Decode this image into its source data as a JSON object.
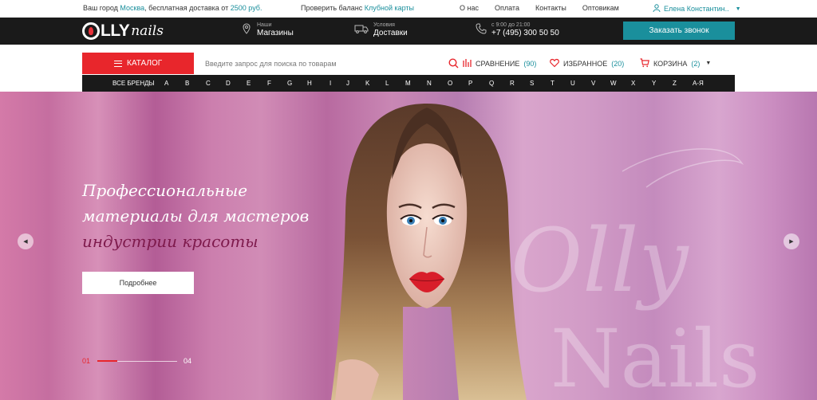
{
  "topbar": {
    "city_prefix": "Ваш город",
    "city": "Москва",
    "city_suffix": ", бесплатная доставка от",
    "free_delivery_amount": "2500 руб.",
    "balance_prefix": "Проверить баланс",
    "balance_link": "Клубной карты",
    "nav": [
      "О нас",
      "Оплата",
      "Контакты",
      "Оптовикам"
    ],
    "user_name": "Елена Константин.."
  },
  "header": {
    "logo_text": "LLY",
    "logo_script": "nails",
    "shops_small": "Наши",
    "shops_big": "Магазины",
    "delivery_small": "Условия",
    "delivery_big": "Доставки",
    "phone_hours": "с 9:00 до 21:00",
    "phone": "+7 (495) 300 50 50",
    "callback_button": "Заказать звонок"
  },
  "searchbar": {
    "catalog_label": "КАТАЛОГ",
    "search_placeholder": "Введите запрос для поиска по товарам",
    "compare_label": "СРАВНЕНИЕ",
    "compare_count": "(90)",
    "favorites_label": "ИЗБРАННОЕ",
    "favorites_count": "(20)",
    "cart_label": "КОРЗИНА",
    "cart_count": "(2)"
  },
  "alphabet": [
    "ВСЕ БРЕНДЫ",
    "A",
    "B",
    "C",
    "D",
    "E",
    "F",
    "G",
    "H",
    "I",
    "J",
    "K",
    "L",
    "M",
    "N",
    "O",
    "P",
    "Q",
    "R",
    "S",
    "T",
    "U",
    "V",
    "W",
    "X",
    "Y",
    "Z",
    "А-Я"
  ],
  "hero": {
    "title_line1": "Профессиональные",
    "title_line2": "материалы для мастеров",
    "title_accent": "индустрии красоты",
    "more_button": "Подробнее",
    "slide_current": "01",
    "slide_total": "04",
    "slide_progress": 0.25,
    "watermark_text_1": "Olly",
    "watermark_text_2": "Nails"
  },
  "colors": {
    "accent_teal": "#1a8f9c",
    "accent_red": "#e8262c",
    "dark": "#1a1a1a"
  }
}
